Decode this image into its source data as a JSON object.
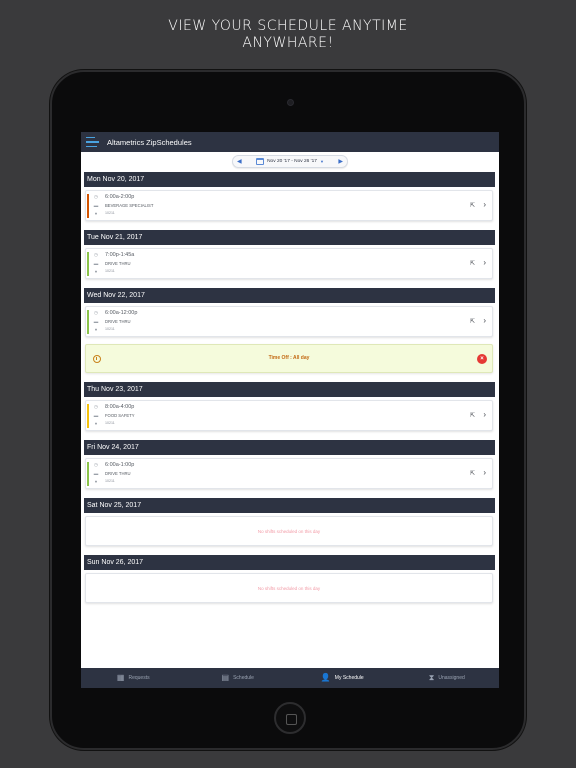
{
  "promo": {
    "line1": "VIEW YOUR SCHEDULE ANYTIME",
    "line2": "ANYWHARE!"
  },
  "app": {
    "title": "Altametrics ZipSchedules"
  },
  "date_selector": {
    "range": "Nov 20 '17 - Nov 26 '17",
    "prev": "◀",
    "next": "▶",
    "caret": "▼"
  },
  "days": [
    {
      "header": "Mon Nov 20, 2017",
      "shift": {
        "time": "6:00a-2:00p",
        "position": "BEVERAGE SPECIALIST",
        "location": "10211",
        "bar_color": "#d35400"
      }
    },
    {
      "header": "Tue Nov 21, 2017",
      "shift": {
        "time": "7:00p-1:45a",
        "position": "DRIVE THRU",
        "location": "10211",
        "bar_color": "#8bc34a"
      }
    },
    {
      "header": "Wed Nov 22, 2017",
      "shift": {
        "time": "6:00a-12:00p",
        "position": "DRIVE THRU",
        "location": "10211",
        "bar_color": "#8bc34a"
      }
    },
    {
      "header": "Thu Nov 23, 2017",
      "shift": {
        "time": "8:00a-4:00p",
        "position": "FOOD SAFETY",
        "location": "10211",
        "bar_color": "#f4c20d"
      }
    },
    {
      "header": "Fri Nov 24, 2017",
      "shift": {
        "time": "6:00a-1:00p",
        "position": "DRIVE THRU",
        "location": "10211",
        "bar_color": "#8bc34a"
      }
    },
    {
      "header": "Sat Nov 25, 2017",
      "empty_text": "No shifts scheduled on this day"
    },
    {
      "header": "Sun Nov 26, 2017",
      "empty_text": "No shifts scheduled on this day"
    }
  ],
  "time_off": {
    "text": "Time Off : All day"
  },
  "tabs": [
    {
      "label": "Requests",
      "icon": "grid-icon"
    },
    {
      "label": "Schedule",
      "icon": "calendar-icon"
    },
    {
      "label": "My Schedule",
      "icon": "user-clock-icon",
      "active": true
    },
    {
      "label": "Unassigned",
      "icon": "hourglass-icon"
    }
  ]
}
